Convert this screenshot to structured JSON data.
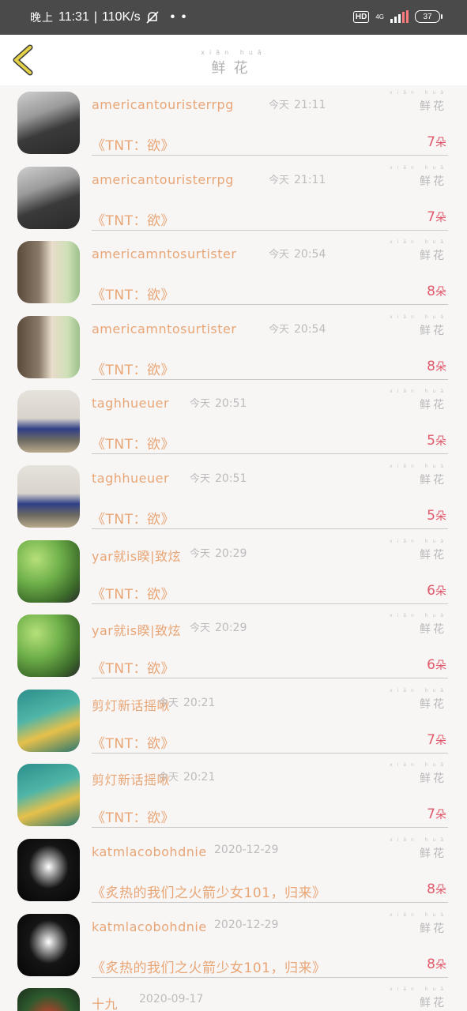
{
  "status_bar": {
    "time_prefix": "晚上",
    "time": "11:31",
    "speed": "110K/s",
    "network": "4G",
    "hd": "HD",
    "battery": "37"
  },
  "header": {
    "title": "鲜花",
    "title_ruby": "xiān huā"
  },
  "flower_label": "鲜花",
  "today_label": "今天",
  "unit_label": "朵",
  "items": [
    {
      "name": "americantouristerrpg",
      "time": "21:11",
      "gift": "《TNT：欲》",
      "count": "7",
      "avatar": "a1"
    },
    {
      "name": "americantouristerrpg",
      "time": "21:11",
      "gift": "《TNT：欲》",
      "count": "7",
      "avatar": "a1"
    },
    {
      "name": "americamntosurtister",
      "time": "20:54",
      "gift": "《TNT：欲》",
      "count": "8",
      "avatar": "a2"
    },
    {
      "name": "americamntosurtister",
      "time": "20:54",
      "gift": "《TNT：欲》",
      "count": "8",
      "avatar": "a2"
    },
    {
      "name": "taghhueuer",
      "time": "20:51",
      "gift": "《TNT：欲》",
      "count": "5",
      "avatar": "a3"
    },
    {
      "name": "taghhueuer",
      "time": "20:51",
      "gift": "《TNT：欲》",
      "count": "5",
      "avatar": "a3"
    },
    {
      "name": "yar就is睽|致炫",
      "time": "20:29",
      "gift": "《TNT：欲》",
      "count": "6",
      "avatar": "a4"
    },
    {
      "name": "yar就is睽|致炫",
      "time": "20:29",
      "gift": "《TNT：欲》",
      "count": "6",
      "avatar": "a4"
    },
    {
      "name": "剪灯新话摇啾",
      "time": "20:21",
      "gift": "《TNT：欲》",
      "count": "7",
      "avatar": "a5"
    },
    {
      "name": "剪灯新话摇啾",
      "time": "20:21",
      "gift": "《TNT：欲》",
      "count": "7",
      "avatar": "a5"
    },
    {
      "name": "katmlacobohdnie",
      "time": "2020-12-29",
      "gift": "《炙热的我们之火箭少女101，归来》",
      "count": "8",
      "avatar": "a6"
    },
    {
      "name": "katmlacobohdnie",
      "time": "2020-12-29",
      "gift": "《炙热的我们之火箭少女101，归来》",
      "count": "8",
      "avatar": "a6"
    },
    {
      "name": "十九",
      "time": "2020-09-17",
      "gift": "",
      "count": "",
      "avatar": "a7"
    }
  ],
  "colors": {
    "accent_name": "#e8a676",
    "count": "#e05a6b",
    "back_icon": "#e3d14a"
  }
}
